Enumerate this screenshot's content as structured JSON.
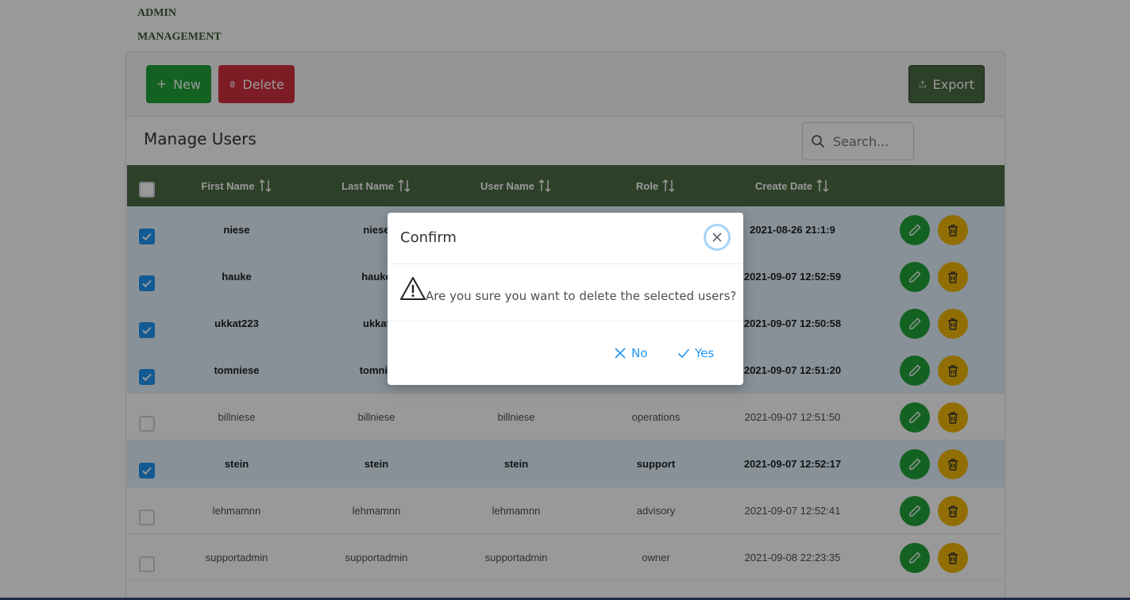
{
  "header": {
    "title_line1": "ADMIN",
    "title_line2": "MANAGEMENT"
  },
  "toolbar": {
    "new_label": "New",
    "delete_label": "Delete",
    "export_label": "Export"
  },
  "card": {
    "title": "Manage Users",
    "search_placeholder": "Search..."
  },
  "table": {
    "columns": [
      "First Name",
      "Last Name",
      "User Name",
      "Role",
      "Create Date"
    ],
    "rows": [
      {
        "first": "niese",
        "last": "niese",
        "user": "",
        "role": "",
        "date": "2021-08-26 21:1:9",
        "selected": true
      },
      {
        "first": "hauke",
        "last": "hauke",
        "user": "",
        "role": "",
        "date": "2021-09-07 12:52:59",
        "selected": true
      },
      {
        "first": "ukkat223",
        "last": "ukkat",
        "user": "",
        "role": "",
        "date": "2021-09-07 12:50:58",
        "selected": true
      },
      {
        "first": "tomniese",
        "last": "tomnie",
        "user": "",
        "role": "",
        "date": "2021-09-07 12:51:20",
        "selected": true
      },
      {
        "first": "billniese",
        "last": "billniese",
        "user": "billniese",
        "role": "operations",
        "date": "2021-09-07 12:51:50",
        "selected": false
      },
      {
        "first": "stein",
        "last": "stein",
        "user": "stein",
        "role": "support",
        "date": "2021-09-07 12:52:17",
        "selected": true
      },
      {
        "first": "lehmamnn",
        "last": "lehmamnn",
        "user": "lehmamnn",
        "role": "advisory",
        "date": "2021-09-07 12:52:41",
        "selected": false
      },
      {
        "first": "supportadmin",
        "last": "supportadmin",
        "user": "supportadmin",
        "role": "owner",
        "date": "2021-09-08 22:23:35",
        "selected": false
      }
    ]
  },
  "dialog": {
    "title": "Confirm",
    "message": "Are you sure you want to delete the selected users?",
    "no_label": "No",
    "yes_label": "Yes"
  },
  "colors": {
    "primary_green": "#22a33a",
    "danger_red": "#d32f3f",
    "header_green": "#4b6b44",
    "warn_yellow": "#f2b707",
    "accent_blue": "#2196f3"
  }
}
